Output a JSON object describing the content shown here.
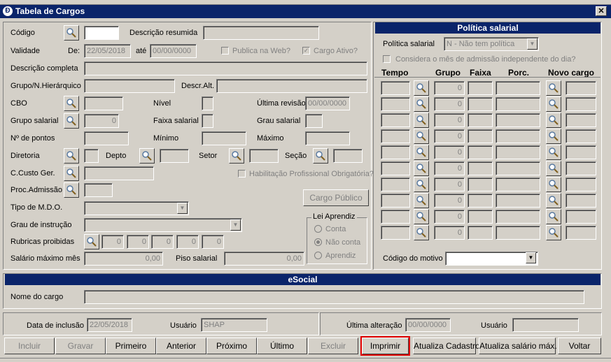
{
  "window": {
    "title": "Tabela de Cargos",
    "close": "✕"
  },
  "form": {
    "codigo_label": "Código",
    "codigo_value": "",
    "descricao_resumida_label": "Descrição resumida",
    "validade_label": "Validade",
    "de_label": "De:",
    "de_value": "22/05/2018",
    "ate_label": "até",
    "ate_value": "00/00/0000",
    "publica_web_label": "Publica na Web?",
    "cargo_ativo_label": "Cargo Ativo?",
    "descricao_completa_label": "Descrição completa",
    "grupo_hierarquico_label": "Grupo/N.Hierárquico",
    "descr_alt_label": "Descr.Alt.",
    "cbo_label": "CBO",
    "nivel_label": "Nível",
    "ultima_revisao_label": "Última revisão",
    "ultima_revisao_value": "00/00/0000",
    "grupo_salarial_label": "Grupo salarial",
    "grupo_salarial_value": "0",
    "faixa_salarial_label": "Faixa salarial",
    "grau_salarial_label": "Grau salarial",
    "n_pontos_label": "Nº de pontos",
    "minimo_label": "Mínimo",
    "maximo_label": "Máximo",
    "diretoria_label": "Diretoria",
    "depto_label": "Depto",
    "setor_label": "Setor",
    "secao_label": "Seção",
    "ccusto_label": "C.Custo Ger.",
    "habilitacao_label": "Habilitação Profissional Obrigatória?",
    "proc_admissao_label": "Proc.Admissão",
    "cargo_publico_button": "Cargo Público",
    "tipo_mdo_label": "Tipo de M.D.O.",
    "grau_instrucao_label": "Grau de instrução",
    "lei_aprendiz_label": "Lei Aprendiz",
    "lei_conta": "Conta",
    "lei_nao_conta": "Não conta",
    "lei_aprendiz_opt": "Aprendiz",
    "rubricas_label": "Rubricas proibidas",
    "rubricas_values": [
      "0",
      "0",
      "0",
      "0",
      "0"
    ],
    "salario_max_label": "Salário máximo mês",
    "salario_max_value": "0,00",
    "piso_label": "Piso salarial",
    "piso_value": "0,00"
  },
  "politica": {
    "title": "Política salarial",
    "politica_label": "Política salarial",
    "politica_value": "N - Não tem política",
    "considera_label": "Considera o mês de admissão independente do dia?",
    "col_tempo": "Tempo",
    "col_grupo": "Grupo",
    "col_faixa": "Faixa",
    "col_porc": "Porc.",
    "col_novo_cargo": "Novo cargo",
    "rows": [
      "0",
      "0",
      "0",
      "0",
      "0",
      "0",
      "0",
      "0",
      "0",
      "0"
    ],
    "motivo_label": "Código do motivo",
    "motivo_value": ""
  },
  "esocial": {
    "title": "eSocial",
    "nome_cargo_label": "Nome do cargo"
  },
  "footer": {
    "data_inclusao_label": "Data de inclusão",
    "data_inclusao_value": "22/05/2018",
    "usuario_label": "Usuário",
    "usuario_value": "SHAP",
    "ultima_alteracao_label": "Última alteração",
    "ultima_alteracao_value": "00/00/0000",
    "usuario2_label": "Usuário",
    "usuario2_value": ""
  },
  "buttons": {
    "incluir": "Incluir",
    "gravar": "Gravar",
    "primeiro": "Primeiro",
    "anterior": "Anterior",
    "proximo": "Próximo",
    "ultimo": "Último",
    "excluir": "Excluir",
    "imprimir": "Imprimir",
    "atualiza_cadastro": "Atualiza Cadastro",
    "atualiza_salario": "Atualiza salário máx.",
    "voltar": "Voltar"
  },
  "icons": {
    "lookup": "magnifier-lookup-icon",
    "app": "app-icon"
  },
  "colors": {
    "titlebar": "#0a246a",
    "highlight": "#e00000",
    "face": "#d4d0c8"
  }
}
